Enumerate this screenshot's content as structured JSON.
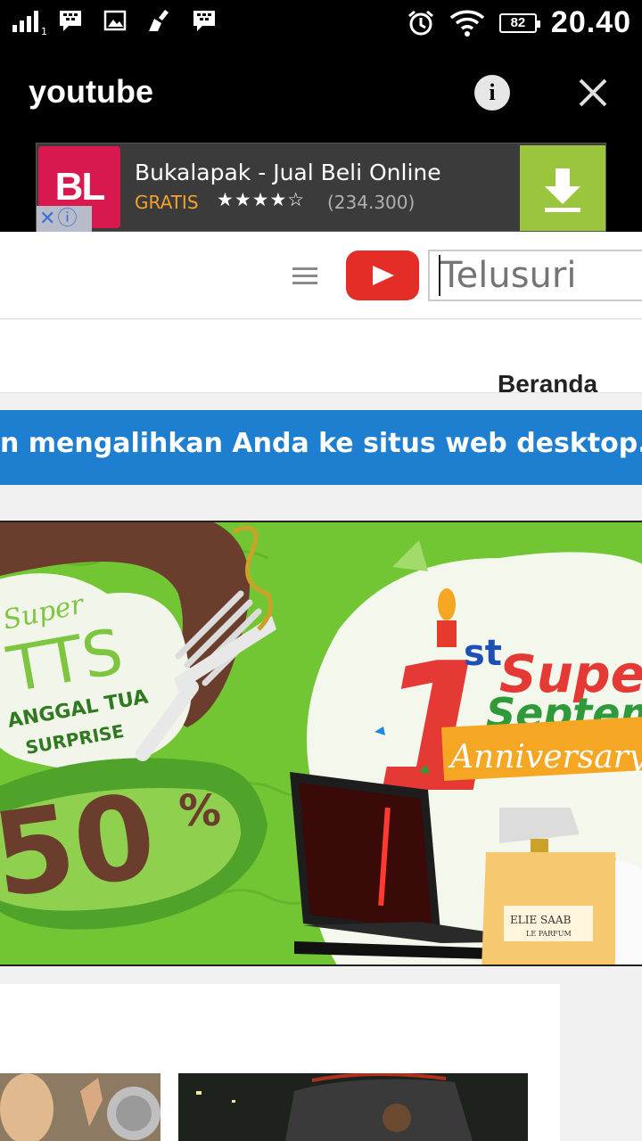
{
  "status_bar": {
    "sim_slot": "1",
    "battery": "82",
    "time": "20.40",
    "icons": [
      "signal-icon",
      "bbm-icon",
      "gallery-icon",
      "cleaner-icon",
      "bbm-icon",
      "alarm-icon",
      "wifi-icon",
      "battery-icon"
    ]
  },
  "titlebar": {
    "title": "youtube"
  },
  "ad": {
    "logo_text": "BL",
    "app_name": "Bukalapak - Jual Beli Online",
    "price": "GRATIS",
    "stars": "★★★★☆",
    "rating_value": 4.5,
    "rating_count": "(234.300)",
    "colors": {
      "logo_bg": "#d7194f",
      "download_bg": "#9bc53d",
      "price": "#f6a12b"
    }
  },
  "youtube": {
    "search_placeholder": "Telusuri",
    "nav_home": "Beranda",
    "notice": "n mengalihkan Anda ke situs web desktop. Kemb",
    "accent": "#e52d27",
    "notice_bg": "#1e7fd0"
  },
  "promo": {
    "super_text": "Super",
    "tts_text": "TTS",
    "line1": "ANGGAL TUA",
    "line2": "SURPRISE",
    "discount": "50",
    "percent": "%",
    "big_one": "1",
    "st": "st",
    "super_sept_1": "Super",
    "super_sept_2": "September",
    "anniversary": "Anniversary",
    "perfume_brand": "ELIE SAAB",
    "perfume_sub": "LE PARFUM"
  }
}
